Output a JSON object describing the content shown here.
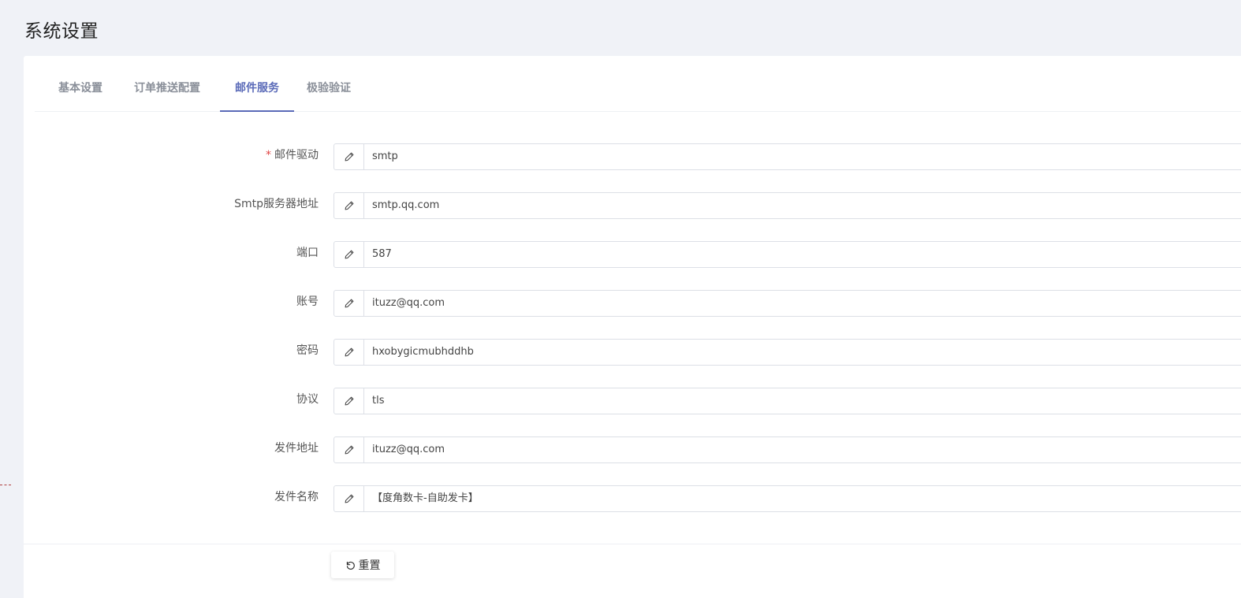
{
  "page": {
    "title": "系统设置"
  },
  "tabs": [
    {
      "label": "基本设置",
      "active": false
    },
    {
      "label": "订单推送配置",
      "active": false
    },
    {
      "label": "邮件服务",
      "active": true
    },
    {
      "label": "极验验证",
      "active": false
    }
  ],
  "form": {
    "fields": [
      {
        "label": "邮件驱动",
        "required": true,
        "value": "smtp",
        "icon": "pencil-icon"
      },
      {
        "label": "Smtp服务器地址",
        "required": false,
        "value": "smtp.qq.com",
        "icon": "pencil-icon"
      },
      {
        "label": "端口",
        "required": false,
        "value": "587",
        "icon": "pencil-icon"
      },
      {
        "label": "账号",
        "required": false,
        "value": "ituzz@qq.com",
        "icon": "pencil-icon"
      },
      {
        "label": "密码",
        "required": false,
        "value": "hxobygicmubhddhb",
        "icon": "pencil-icon"
      },
      {
        "label": "协议",
        "required": false,
        "value": "tls",
        "icon": "pencil-icon"
      },
      {
        "label": "发件地址",
        "required": false,
        "value": "ituzz@qq.com",
        "icon": "pencil-icon"
      },
      {
        "label": "发件名称",
        "required": false,
        "value": "【度角数卡-自助发卡】",
        "icon": "pencil-icon"
      }
    ],
    "required_mark": "*"
  },
  "actions": {
    "reset_label": "重置",
    "reset_icon": "undo-icon"
  },
  "colors": {
    "accent": "#5a6ab8",
    "required": "#e04343",
    "background": "#f0f2f7"
  }
}
